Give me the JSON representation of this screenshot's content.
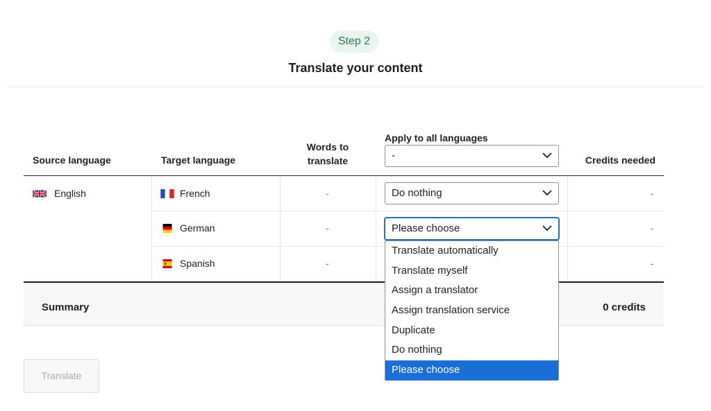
{
  "step": {
    "label": "Step 2"
  },
  "title": "Translate your content",
  "headers": {
    "source": "Source language",
    "target": "Target language",
    "words_line1": "Words to",
    "words_line2": "translate",
    "apply": "Apply to all languages",
    "credits": "Credits needed"
  },
  "apply_all": {
    "value": "-"
  },
  "source_language": {
    "name": "English",
    "flag_icon": "uk-flag-icon"
  },
  "rows": [
    {
      "language": "French",
      "flag_icon": "french-flag-icon",
      "words": "-",
      "action": "Do nothing",
      "credits": "-"
    },
    {
      "language": "German",
      "flag_icon": "german-flag-icon",
      "words": "-",
      "action": "Please choose",
      "credits": "-"
    },
    {
      "language": "Spanish",
      "flag_icon": "spanish-flag-icon",
      "words": "-",
      "action": "",
      "credits": "-"
    }
  ],
  "dropdown": {
    "options": [
      "Translate automatically",
      "Translate myself",
      "Assign a translator",
      "Assign translation service",
      "Duplicate",
      "Do nothing",
      "Please choose"
    ],
    "selected": "Please choose"
  },
  "summary": {
    "label": "Summary",
    "credits": "0 credits"
  },
  "translate_button": {
    "label": "Translate",
    "disabled": true
  },
  "colors": {
    "step_bg": "#e9f5ef",
    "step_text": "#2a7a55",
    "focus": "#2271b1",
    "selected_option": "#1a6fd6"
  }
}
